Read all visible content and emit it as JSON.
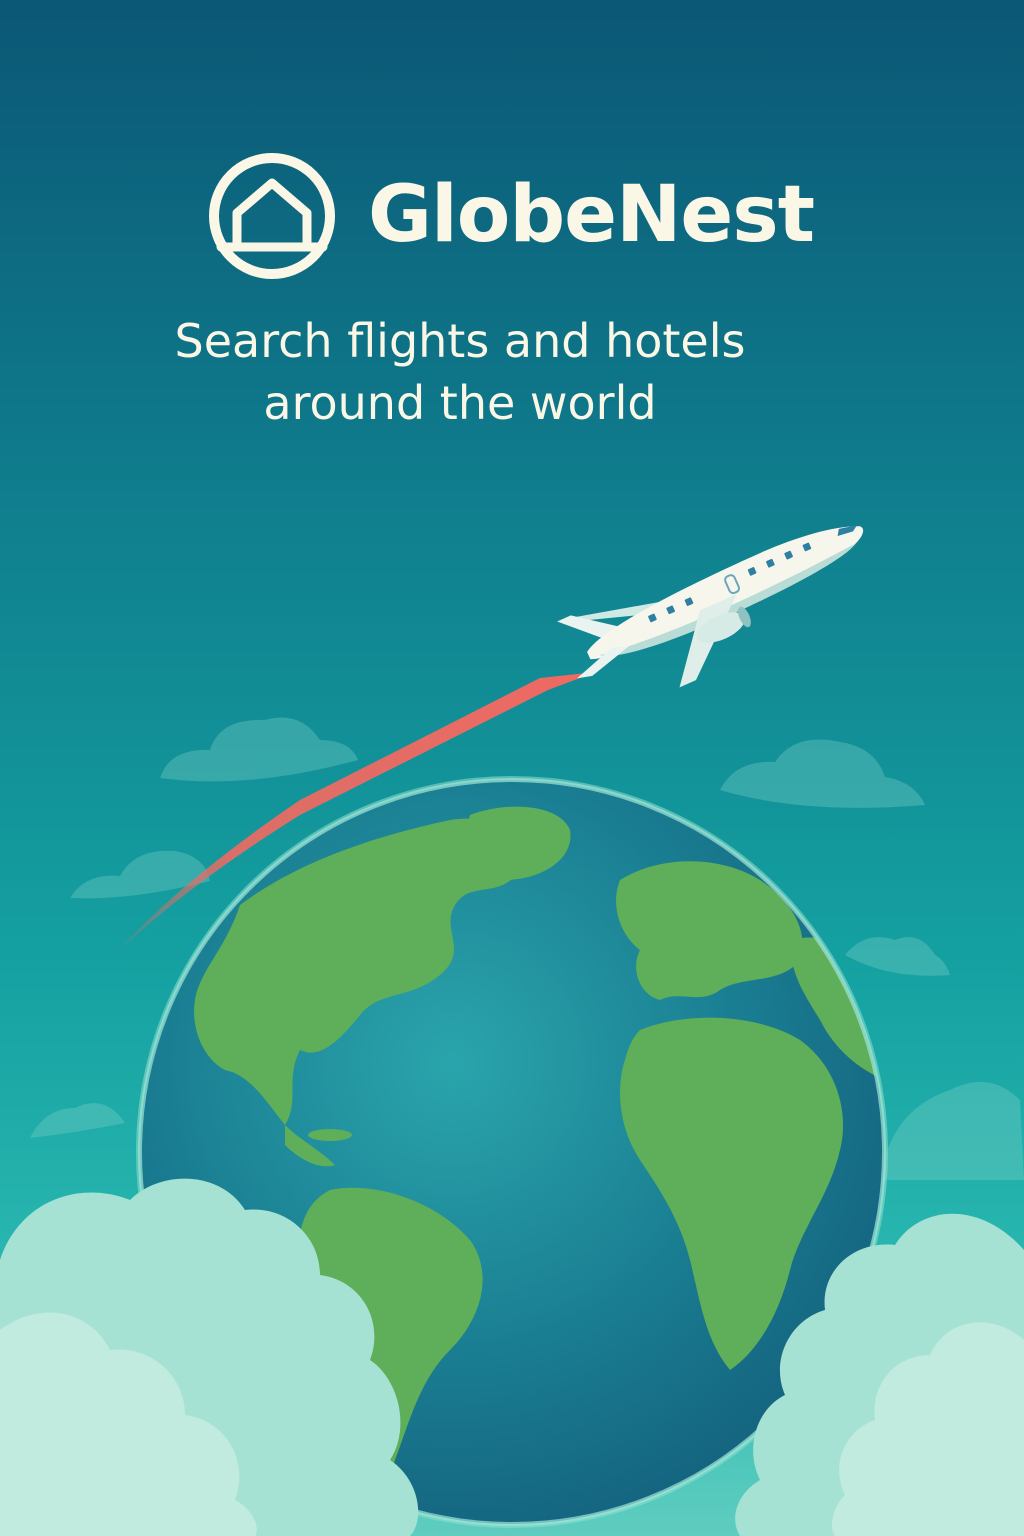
{
  "brand": {
    "name": "GlobeNest",
    "logo_icon": "house-in-circle-icon"
  },
  "tagline": {
    "line1": "Search flights and hotels",
    "line2": "around the world"
  },
  "illustration": {
    "globe_icon": "globe-icon",
    "airplane_icon": "airplane-icon",
    "trail_color": "#ef6a62"
  },
  "colors": {
    "background_top": "#0b5775",
    "background_bottom": "#5fcdbf",
    "text": "#fbf7e6",
    "ocean": "#1f7f93",
    "land": "#5fae5a"
  }
}
